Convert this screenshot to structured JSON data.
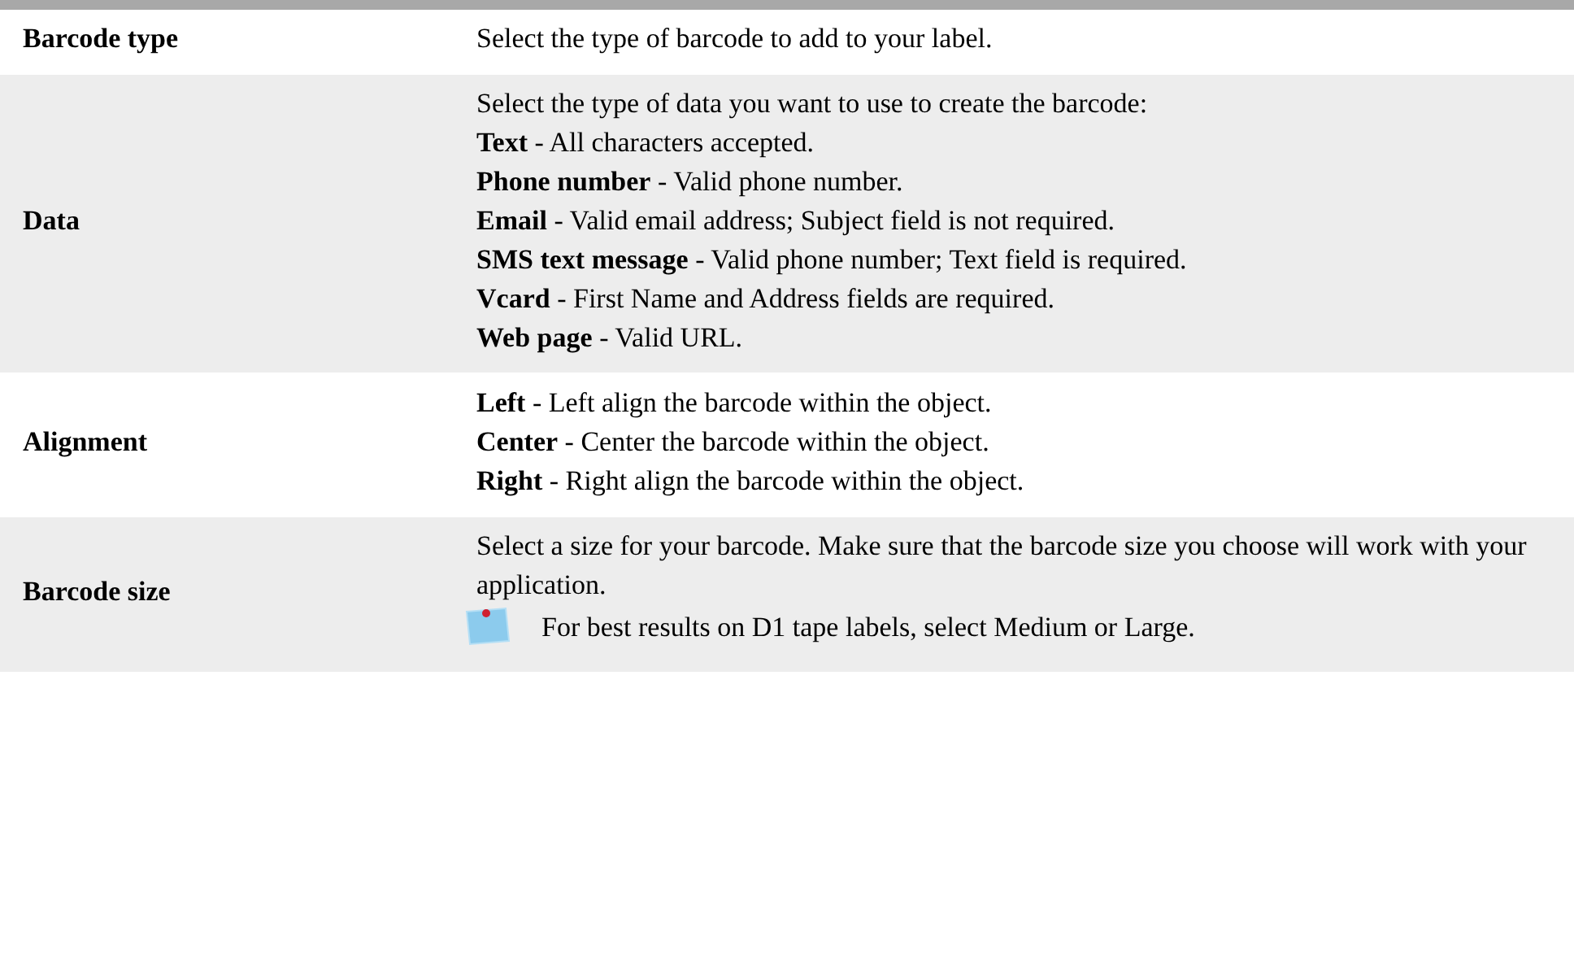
{
  "table": {
    "rows": [
      {
        "label": "Barcode type",
        "lines": [
          {
            "kind": "text",
            "text": "Select the type of barcode to add to your label."
          }
        ]
      },
      {
        "label": "Data",
        "lines": [
          {
            "kind": "text",
            "text": "Select the type of data you want to use to create the barcode:"
          },
          {
            "kind": "text",
            "text": "**Text** - All characters accepted."
          },
          {
            "kind": "text",
            "text": "**Phone number** - Valid phone number."
          },
          {
            "kind": "text",
            "text": "**Email** - Valid email address; Subject field is not required."
          },
          {
            "kind": "text",
            "text": "**SMS text message** - Valid phone number; Text field is required."
          },
          {
            "kind": "text",
            "text": "**Vcard** - First Name and Address fields are required."
          },
          {
            "kind": "text",
            "text": "**Web page** - Valid URL."
          }
        ]
      },
      {
        "label": "Alignment",
        "lines": [
          {
            "kind": "text",
            "text": "**Left** - Left align the barcode within the object."
          },
          {
            "kind": "text",
            "text": "**Center** - Center the barcode within the object."
          },
          {
            "kind": "text",
            "text": "**Right** - Right align the barcode within the object."
          }
        ]
      },
      {
        "label": "Barcode size",
        "lines": [
          {
            "kind": "text",
            "text": "Select a size for your barcode. Make sure that the barcode size you choose will work with your application."
          },
          {
            "kind": "note",
            "text": "For best results on D1 tape labels, select Medium or Large."
          }
        ]
      }
    ]
  }
}
